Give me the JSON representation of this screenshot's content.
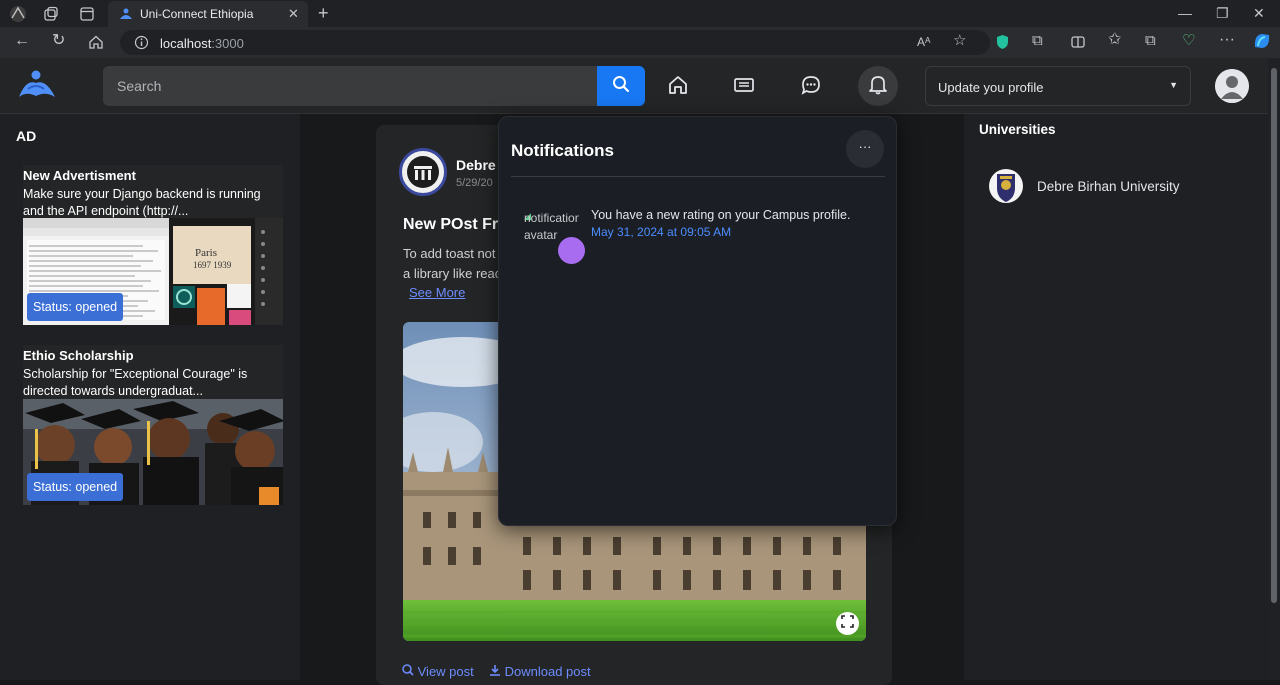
{
  "browser": {
    "tab_title": "Uni-Connect Ethiopia",
    "url_host": "localhost",
    "url_port": ":3000"
  },
  "header": {
    "search_placeholder": "Search",
    "profile_select_label": "Update you profile"
  },
  "left": {
    "section_title": "AD",
    "ads": [
      {
        "title": "New Advertisment",
        "text": "Make sure your Django backend is running and the API endpoint (http://...",
        "status": "Status: opened",
        "img_text_1": "Paris",
        "img_text_2": "1697 1939"
      },
      {
        "title": "Ethio Scholarship",
        "text": "Scholarship for \"Exceptional Courage\" is directed towards undergraduat...",
        "status": "Status: opened"
      }
    ]
  },
  "post": {
    "author": "Debre",
    "date": "5/29/20",
    "title": "New POst Fr",
    "body_line_1": "To add toast not",
    "body_line_2": "a library like reac",
    "see_more": "See More",
    "view_post": "View post",
    "download_post": "Download post"
  },
  "notifications": {
    "title": "Notifications",
    "more_label": "···",
    "items": [
      {
        "img_alt": "notification avatar",
        "text": "You have a new rating on your Campus profile.",
        "time": "May 31, 2024 at 09:05 AM"
      }
    ]
  },
  "right": {
    "section_title": "Universities",
    "universities": [
      {
        "name": "Debre Birhan University"
      }
    ]
  },
  "colors": {
    "accent": "#1877f2",
    "link": "#6c8cff",
    "status_badge": "#3b6fd6",
    "notif_dot": "#a76cf0"
  }
}
